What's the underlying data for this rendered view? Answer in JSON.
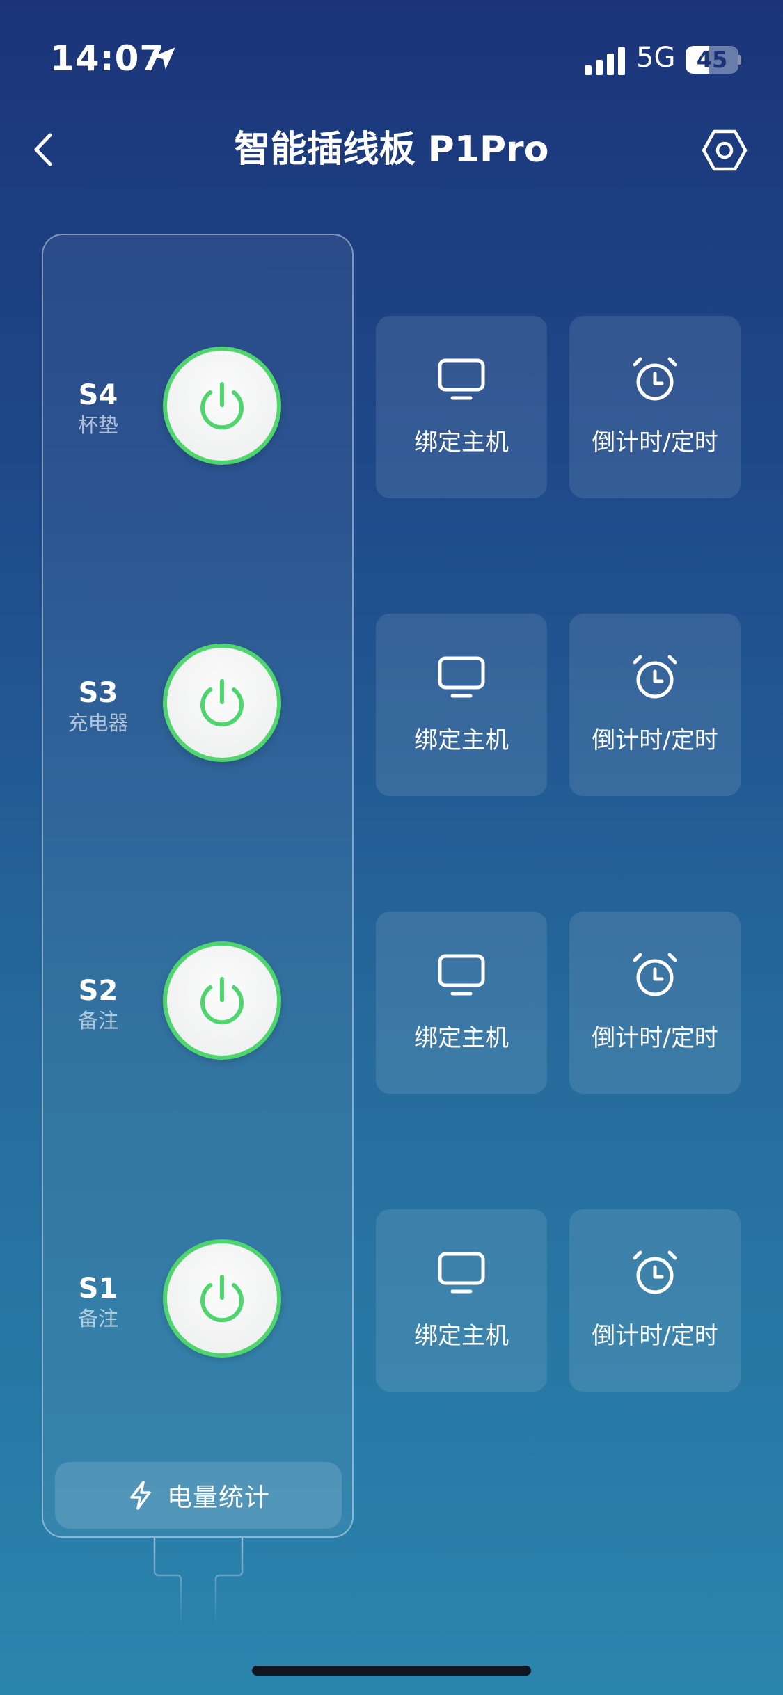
{
  "status_bar": {
    "time": "14:07",
    "network": "5G",
    "battery": "45",
    "battery_percent": 45
  },
  "header": {
    "title": "智能插线板 P1Pro"
  },
  "sockets": [
    {
      "id": "S4",
      "note": "杯垫",
      "on": true
    },
    {
      "id": "S3",
      "note": "充电器",
      "on": true
    },
    {
      "id": "S2",
      "note": "备注",
      "on": true
    },
    {
      "id": "S1",
      "note": "备注",
      "on": true
    }
  ],
  "actions": {
    "bind_host": "绑定主机",
    "timer": "倒计时/定时"
  },
  "energy_stats": "电量统计",
  "colors": {
    "power_on_green": "#4fd56e",
    "bg_top": "#1b3479",
    "bg_bottom": "#2a85ad"
  },
  "icons": {
    "back": "chevron-left-icon",
    "settings": "hexagon-settings-icon",
    "power": "power-icon",
    "monitor": "monitor-icon",
    "alarm": "alarm-clock-icon",
    "bolt": "lightning-bolt-icon"
  }
}
